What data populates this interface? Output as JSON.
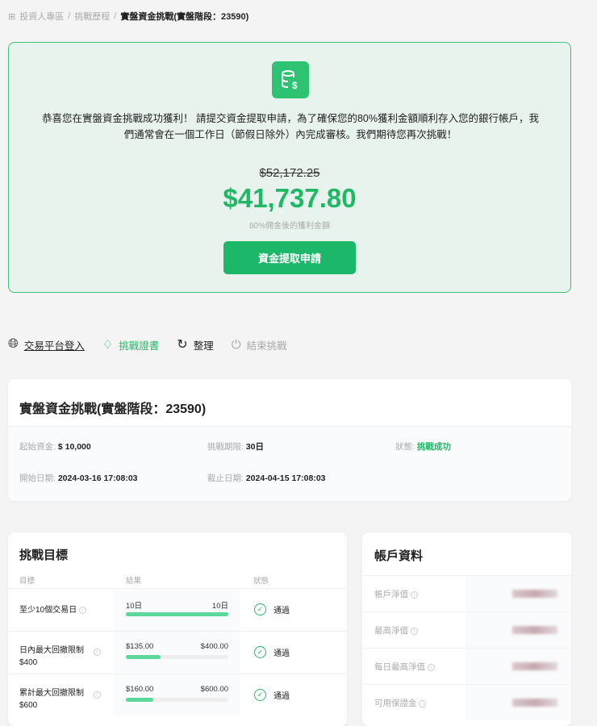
{
  "breadcrumb": [
    "投資人專區",
    "挑戰歷程",
    "實盤資金挑戰(實盤階段：23590)"
  ],
  "banner": {
    "message": "恭喜您在實盤資金挑戰成功獲利！ 請提交資金提取申請，為了確保您的80%獲利金額順利存入您的銀行帳戶，我們通常會在一個工作日（節假日除外）內完成審核。我們期待您再次挑戰！",
    "original_amount": "$52,172.25",
    "amount": "$41,737.80",
    "amount_label": "80%佣金後的獲利金額",
    "button": "資金提取申請"
  },
  "actions": [
    {
      "label": "交易平台登入",
      "icon": "globe-icon"
    },
    {
      "label": "挑戰證書",
      "icon": "diamond-icon"
    },
    {
      "label": "整理",
      "icon": "refresh-icon"
    },
    {
      "label": "結束挑戰",
      "icon": "power-icon"
    }
  ],
  "info": {
    "title": "實盤資金挑戰(實盤階段：23590)",
    "start_capital_label": "起始資金:",
    "start_capital": "$ 10,000",
    "period_label": "挑戰期限:",
    "period": "30日",
    "status_label": "狀態:",
    "status": "挑戰成功",
    "start_date_label": "開始日期:",
    "start_date": "2024-03-16 17:08:03",
    "end_date_label": "截止日期:",
    "end_date": "2024-04-15 17:08:03"
  },
  "goals": {
    "title": "挑戰目標",
    "headers": [
      "目標",
      "結果",
      "狀態"
    ],
    "rows": [
      {
        "l1": "至少10個交易日",
        "l2": "",
        "cur": "10日",
        "max": "10日",
        "progress": 1.0,
        "status": "通過"
      },
      {
        "l1": "日內最大回撤限制",
        "l2": "$400",
        "cur": "$135.00",
        "max": "$400.00",
        "progress": 0.34,
        "status": "通過"
      },
      {
        "l1": "累計最大回撤限制",
        "l2": "$600",
        "cur": "$160.00",
        "max": "$600.00",
        "progress": 0.27,
        "status": "通過"
      }
    ]
  },
  "account": {
    "title": "帳戶資料",
    "rows": [
      "帳戶淨值",
      "最高淨值",
      "每日最高淨值",
      "可用保證金"
    ]
  },
  "colors": {
    "green": "#1db76a",
    "bg": "#f4f4f5"
  }
}
